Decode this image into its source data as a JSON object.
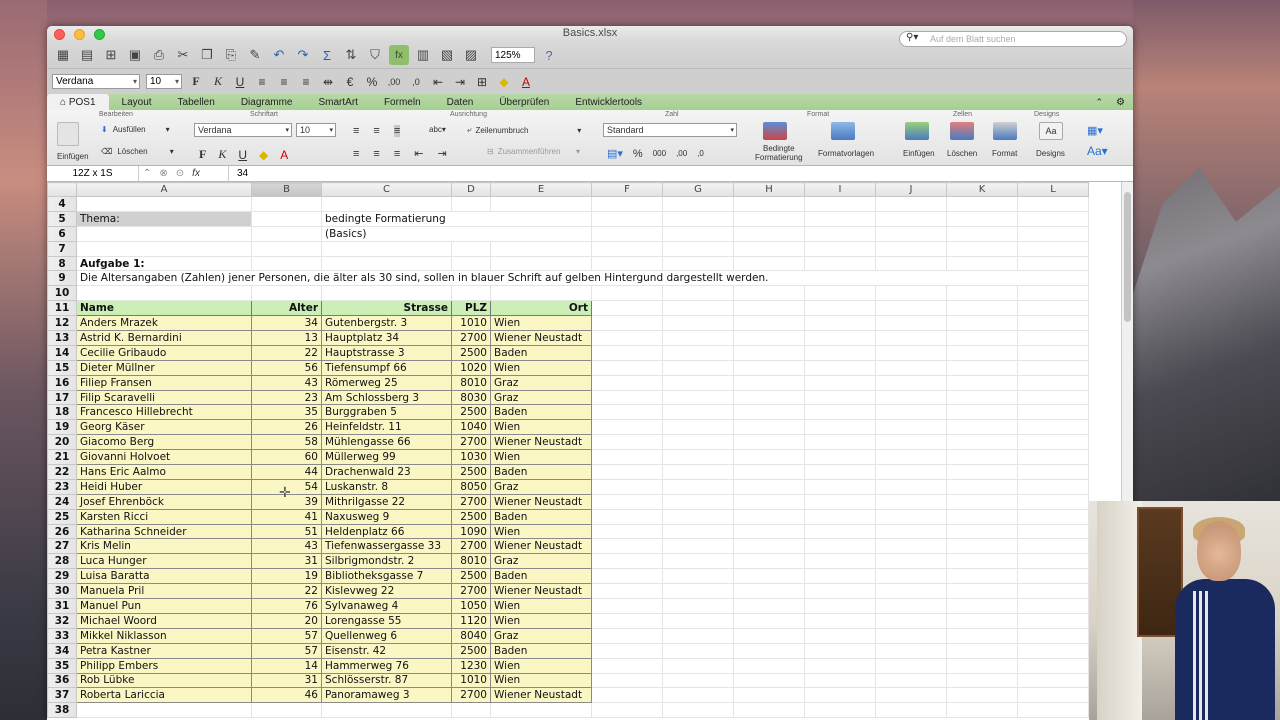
{
  "window": {
    "title": "Basics.xlsx"
  },
  "toolbar": {
    "zoom": "125%",
    "search_placeholder": "Auf dem Blatt suchen"
  },
  "format_bar": {
    "font": "Verdana",
    "size": "10"
  },
  "tabs": [
    "POS1",
    "Layout",
    "Tabellen",
    "Diagramme",
    "SmartArt",
    "Formeln",
    "Daten",
    "Überprüfen",
    "Entwicklertools"
  ],
  "ribbon": {
    "groups": {
      "bearbeiten": "Bearbeiten",
      "schriftart": "Schriftart",
      "ausrichtung": "Ausrichtung",
      "zahl": "Zahl",
      "format": "Format",
      "zellen": "Zellen",
      "designs": "Designs"
    },
    "einfuegen": "Einfügen",
    "ausfuellen": "Ausfüllen",
    "loeschen": "Löschen",
    "font": "Verdana",
    "size": "10",
    "wrap": "Zeilenumbruch",
    "merge": "Zusammenführen",
    "numformat": "Standard",
    "cond_fmt_1": "Bedingte",
    "cond_fmt_2": "Formatierung",
    "fmt_templates": "Formatvorlagen",
    "cells_insert": "Einfügen",
    "cells_delete": "Löschen",
    "cells_format": "Format",
    "designs": "Designs"
  },
  "formula_bar": {
    "name_box": "12Z x 1S",
    "value": "34"
  },
  "columns": [
    "A",
    "B",
    "C",
    "D",
    "E",
    "F",
    "G",
    "H",
    "I",
    "J",
    "K",
    "L"
  ],
  "sheet": {
    "thema_label": "Thema:",
    "thema_value": "bedingte Formatierung",
    "thema_sub": "(Basics)",
    "task_title": "Aufgabe 1:",
    "task_text": "Die Altersangaben (Zahlen) jener Personen, die älter als 30 sind, sollen in blauer Schrift auf gelben Hintergund dargestellt werden.",
    "headers": [
      "Name",
      "Alter",
      "Strasse",
      "PLZ",
      "Ort"
    ],
    "rows": [
      [
        "Anders Mrazek",
        "34",
        "Gutenbergstr. 3",
        "1010",
        "Wien"
      ],
      [
        "Astrid K. Bernardini",
        "13",
        "Hauptplatz 34",
        "2700",
        "Wiener Neustadt"
      ],
      [
        "Cecilie Gribaudo",
        "22",
        "Hauptstrasse 3",
        "2500",
        "Baden"
      ],
      [
        "Dieter Müllner",
        "56",
        "Tiefensumpf 66",
        "1020",
        "Wien"
      ],
      [
        "Filiep Fransen",
        "43",
        "Römerweg 25",
        "8010",
        "Graz"
      ],
      [
        "Filip Scaravelli",
        "23",
        "Am Schlossberg 3",
        "8030",
        "Graz"
      ],
      [
        "Francesco Hillebrecht",
        "35",
        "Burggraben 5",
        "2500",
        "Baden"
      ],
      [
        "Georg Käser",
        "26",
        "Heinfeldstr. 11",
        "1040",
        "Wien"
      ],
      [
        "Giacomo Berg",
        "58",
        "Mühlengasse 66",
        "2700",
        "Wiener Neustadt"
      ],
      [
        "Giovanni Holvoet",
        "60",
        "Müllerweg 99",
        "1030",
        "Wien"
      ],
      [
        "Hans Eric Aalmo",
        "44",
        "Drachenwald 23",
        "2500",
        "Baden"
      ],
      [
        "Heidi Huber",
        "54",
        "Luskanstr. 8",
        "8050",
        "Graz"
      ],
      [
        "Josef Ehrenböck",
        "39",
        "Mithrilgasse 22",
        "2700",
        "Wiener Neustadt"
      ],
      [
        "Karsten Ricci",
        "41",
        "Naxusweg 9",
        "2500",
        "Baden"
      ],
      [
        "Katharina Schneider",
        "51",
        "Heldenplatz 66",
        "1090",
        "Wien"
      ],
      [
        "Kris Melin",
        "43",
        "Tiefenwassergasse 33",
        "2700",
        "Wiener Neustadt"
      ],
      [
        "Luca Hunger",
        "31",
        "Silbrigmondstr. 2",
        "8010",
        "Graz"
      ],
      [
        "Luisa Baratta",
        "19",
        "Bibliotheksgasse 7",
        "2500",
        "Baden"
      ],
      [
        "Manuela Pril",
        "22",
        "Kislevweg 22",
        "2700",
        "Wiener Neustadt"
      ],
      [
        "Manuel Pun",
        "76",
        "Sylvanaweg 4",
        "1050",
        "Wien"
      ],
      [
        "Michael Woord",
        "20",
        "Lorengasse 55",
        "1120",
        "Wien"
      ],
      [
        "Mikkel Niklasson",
        "57",
        "Quellenweg 6",
        "8040",
        "Graz"
      ],
      [
        "Petra Kastner",
        "57",
        "Eisenstr. 42",
        "2500",
        "Baden"
      ],
      [
        "Philipp Embers",
        "14",
        "Hammerweg 76",
        "1230",
        "Wien"
      ],
      [
        "Rob Lübke",
        "31",
        "Schlösserstr. 87",
        "1010",
        "Wien"
      ],
      [
        "Roberta Lariccia",
        "46",
        "Panoramaweg 3",
        "2700",
        "Wiener Neustadt"
      ]
    ]
  }
}
